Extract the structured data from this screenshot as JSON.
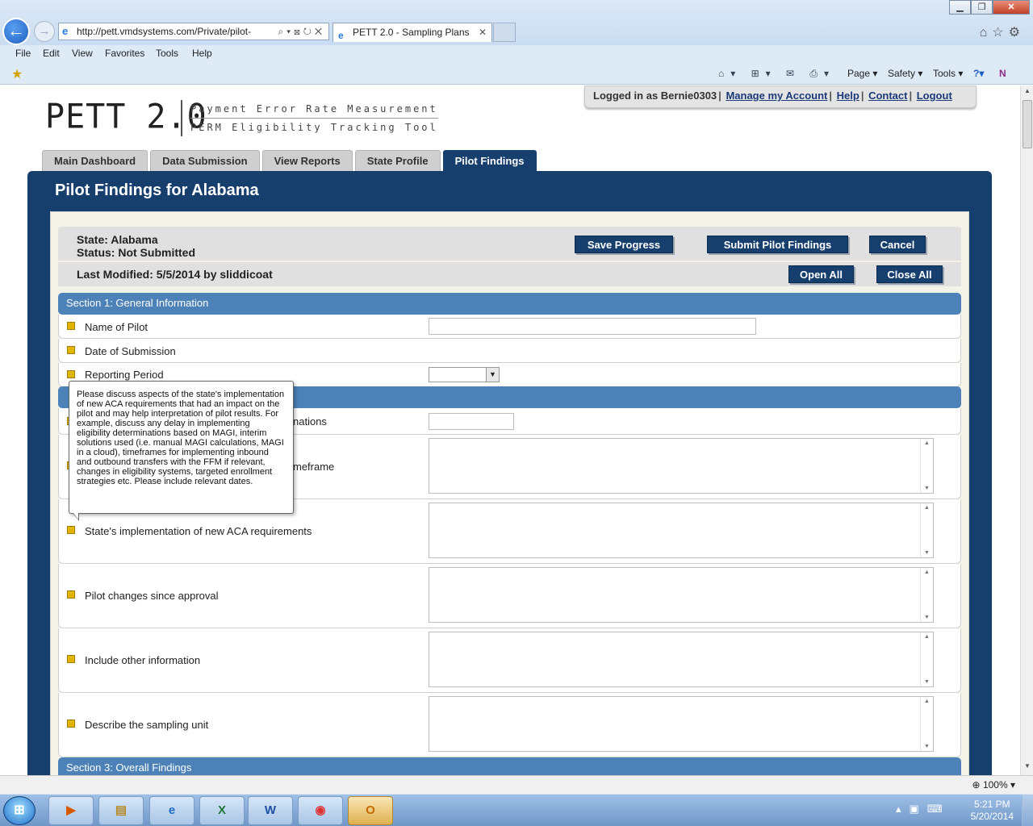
{
  "browser": {
    "url": "http://pett.vmdsystems.com/Private/pilot-",
    "tab_title": "PETT 2.0 - Sampling Plans",
    "menu": [
      "File",
      "Edit",
      "View",
      "Favorites",
      "Tools",
      "Help"
    ],
    "commands": [
      "Page ▾",
      "Safety ▾",
      "Tools ▾"
    ],
    "zoom": "100%"
  },
  "header": {
    "logo": "PETT 2.0",
    "logo_line1": "Payment Error Rate Measurement",
    "logo_line2": "PERM Eligibility Tracking Tool",
    "logged_in": "Logged in as Bernie0303",
    "links": [
      "Manage my Account",
      "Help",
      "Contact",
      "Logout"
    ]
  },
  "tabs": [
    "Main Dashboard",
    "Data Submission",
    "View Reports",
    "State Profile",
    "Pilot Findings"
  ],
  "panel": {
    "title": "Pilot Findings for Alabama",
    "state": "State: Alabama",
    "status": "Status: Not Submitted",
    "last_modified": "Last Modified: 5/5/2014 by sliddicoat",
    "buttons": {
      "save": "Save Progress",
      "submit": "Submit Pilot Findings",
      "cancel": "Cancel",
      "open_all": "Open All",
      "close_all": "Close All"
    }
  },
  "sections": {
    "s1": "Section 1: General Information",
    "s3": "Section 3: Overall Findings"
  },
  "fields": {
    "name_of_pilot": "Name of Pilot",
    "date_of_submission": "Date of Submission",
    "reporting_period": "Reporting Period",
    "partial_determinations": "nations",
    "partial_timeframe": "meframe",
    "aca": "State's implementation of new ACA requirements",
    "pilot_changes": "Pilot changes since approval",
    "other_info": "Include other information",
    "sampling_unit": "Describe the sampling unit"
  },
  "tooltip": "Please discuss aspects of the state's implementation of new ACA requirements that had an impact on the pilot and may help interpretation of pilot results. For example, discuss any delay in implementing eligibility determinations based on MAGI, interim solutions used (i.e. manual MAGI calculations, MAGI in a cloud), timeframes for implementing inbound and outbound transfers with the FFM if relevant, changes in eligibility systems, targeted enrollment strategies etc. Please include relevant dates.",
  "taskbar": {
    "time": "5:21 PM",
    "date": "5/20/2014"
  }
}
